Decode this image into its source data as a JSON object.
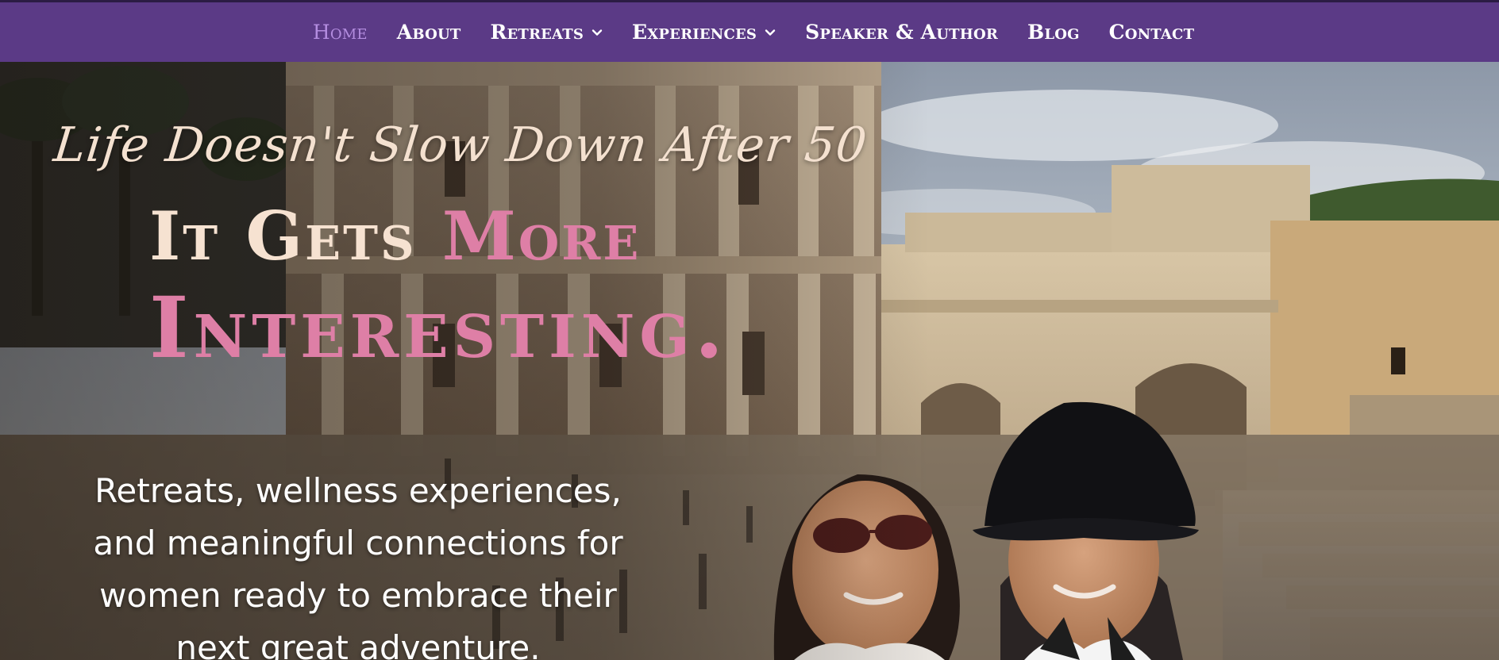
{
  "nav": {
    "items": [
      {
        "label": "Home",
        "active": true,
        "has_dropdown": false
      },
      {
        "label": "About",
        "active": false,
        "has_dropdown": false
      },
      {
        "label": "Retreats",
        "active": false,
        "has_dropdown": true
      },
      {
        "label": "Experiences",
        "active": false,
        "has_dropdown": true
      },
      {
        "label": "Speaker & Author",
        "active": false,
        "has_dropdown": false
      },
      {
        "label": "Blog",
        "active": false,
        "has_dropdown": false
      },
      {
        "label": "Contact",
        "active": false,
        "has_dropdown": false
      }
    ]
  },
  "hero": {
    "script_tagline": "Life Doesn't Slow Down After 50",
    "headline_part_a": "It Gets ",
    "headline_part_b": "More",
    "headline_line2": "Interesting.",
    "subtext": "Retreats, wellness experiences, and meaningful connections for women ready to embrace their next great adventure."
  },
  "colors": {
    "nav_bg": "#5b3a86",
    "nav_active": "#b48de0",
    "headline_cream": "#f6e2d1",
    "headline_pink": "#de7fa6"
  },
  "icons": {
    "dropdown": "chevron-down-icon"
  }
}
